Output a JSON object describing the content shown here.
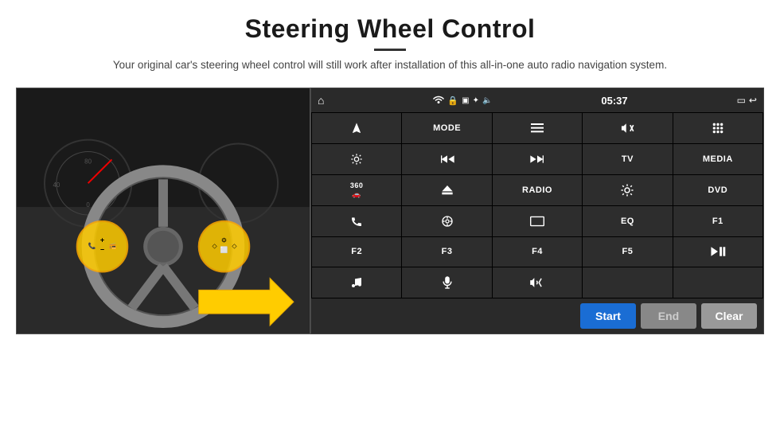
{
  "page": {
    "title": "Steering Wheel Control",
    "subtitle": "Your original car's steering wheel control will still work after installation of this all-in-one auto radio navigation system."
  },
  "status_bar": {
    "home_icon": "⌂",
    "wifi_icon": "wifi",
    "lock_icon": "🔒",
    "sd_icon": "SD",
    "bt_icon": "bt",
    "time": "05:37",
    "back_icon": "⬅"
  },
  "grid_buttons": [
    {
      "label": "✈",
      "row": 1,
      "col": 1
    },
    {
      "label": "MODE",
      "row": 1,
      "col": 2
    },
    {
      "label": "≡",
      "row": 1,
      "col": 3
    },
    {
      "label": "🔇",
      "row": 1,
      "col": 4
    },
    {
      "label": "⋯",
      "row": 1,
      "col": 5
    },
    {
      "label": "⚙",
      "row": 2,
      "col": 1
    },
    {
      "label": "⏮",
      "row": 2,
      "col": 2
    },
    {
      "label": "⏭",
      "row": 2,
      "col": 3
    },
    {
      "label": "TV",
      "row": 2,
      "col": 4
    },
    {
      "label": "MEDIA",
      "row": 2,
      "col": 5
    },
    {
      "label": "360",
      "row": 3,
      "col": 1
    },
    {
      "label": "▲",
      "row": 3,
      "col": 2
    },
    {
      "label": "RADIO",
      "row": 3,
      "col": 3
    },
    {
      "label": "☀",
      "row": 3,
      "col": 4
    },
    {
      "label": "DVD",
      "row": 3,
      "col": 5
    },
    {
      "label": "📞",
      "row": 4,
      "col": 1
    },
    {
      "label": "🔃",
      "row": 4,
      "col": 2
    },
    {
      "label": "▭",
      "row": 4,
      "col": 3
    },
    {
      "label": "EQ",
      "row": 4,
      "col": 4
    },
    {
      "label": "F1",
      "row": 4,
      "col": 5
    },
    {
      "label": "F2",
      "row": 5,
      "col": 1
    },
    {
      "label": "F3",
      "row": 5,
      "col": 2
    },
    {
      "label": "F4",
      "row": 5,
      "col": 3
    },
    {
      "label": "F5",
      "row": 5,
      "col": 4
    },
    {
      "label": "▶⏸",
      "row": 5,
      "col": 5
    },
    {
      "label": "♪",
      "row": 6,
      "col": 1
    },
    {
      "label": "🎙",
      "row": 6,
      "col": 2
    },
    {
      "label": "🔈/↩",
      "row": 6,
      "col": 3
    },
    {
      "label": "",
      "row": 6,
      "col": 4
    },
    {
      "label": "",
      "row": 6,
      "col": 5
    }
  ],
  "action_buttons": {
    "start": "Start",
    "end": "End",
    "clear": "Clear"
  }
}
